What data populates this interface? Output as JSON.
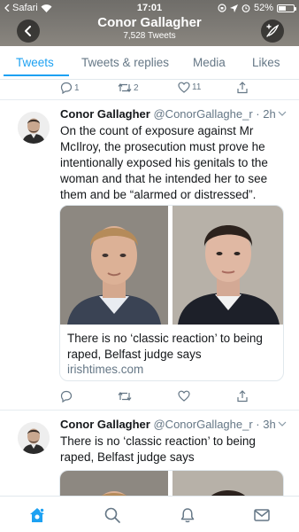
{
  "status_bar": {
    "carrier": "Safari",
    "time": "17:01",
    "battery": "52%",
    "battery_level": 0.52
  },
  "profile_header": {
    "name": "Conor Gallagher",
    "tweet_count": "7,528 Tweets"
  },
  "tabs": [
    {
      "label": "Tweets",
      "active": true
    },
    {
      "label": "Tweets & replies",
      "active": false
    },
    {
      "label": "Media",
      "active": false
    },
    {
      "label": "Likes",
      "active": false
    }
  ],
  "prev_tweet_actions": {
    "replies": "1",
    "retweets": "2",
    "likes": "11"
  },
  "tweets": [
    {
      "name": "Conor Gallagher",
      "handle_time": "@ConorGallaghe_r · 2h",
      "lines": [
        "On the count of exposure against Mr",
        "McIlroy, the prosecution must prove he",
        "intentionally exposed his genitals to the",
        "woman and that he intended her to see",
        "them and be “alarmed or distressed”."
      ],
      "card": {
        "title_lines": [
          "There is no ‘classic reaction’ to being",
          "raped, Belfast judge says"
        ],
        "domain": "irishtimes.com"
      }
    },
    {
      "name": "Conor Gallagher",
      "handle_time": "@ConorGallaghe_r · 3h",
      "lines": [
        "There is no ‘classic reaction’ to being",
        "raped, Belfast judge says"
      ]
    }
  ],
  "colors": {
    "accent": "#1da1f2",
    "muted": "#657786",
    "header_bg": "#7b7873"
  },
  "icons": [
    "back-arrow-icon",
    "compose-tweet-icon",
    "reply-icon",
    "retweet-icon",
    "like-icon",
    "share-icon",
    "home-icon",
    "search-icon",
    "notifications-icon",
    "messages-icon"
  ]
}
